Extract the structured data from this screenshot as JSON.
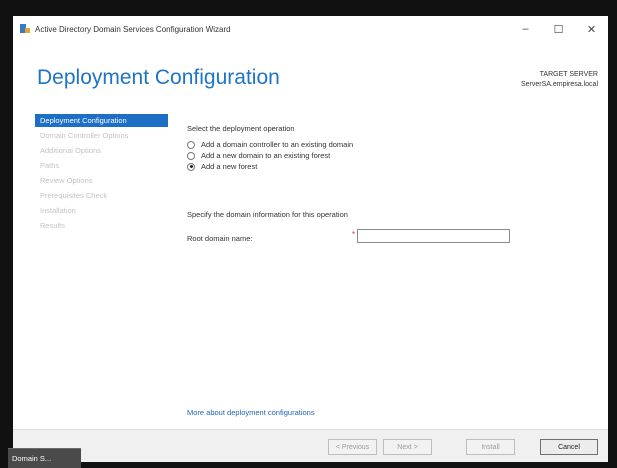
{
  "window": {
    "title": "Active Directory Domain Services Configuration Wizard",
    "controls": {
      "minimize": "–",
      "maximize": "☐",
      "close": "✕"
    }
  },
  "header": {
    "title": "Deployment Configuration",
    "target_label": "TARGET SERVER",
    "target_value": "ServerSA.empiresa.local"
  },
  "sidebar": {
    "items": [
      {
        "label": "Deployment Configuration",
        "active": true
      },
      {
        "label": "Domain Controller Options",
        "active": false
      },
      {
        "label": "Additional Options",
        "active": false
      },
      {
        "label": "Paths",
        "active": false
      },
      {
        "label": "Review Options",
        "active": false
      },
      {
        "label": "Prerequisites Check",
        "active": false
      },
      {
        "label": "Installation",
        "active": false
      },
      {
        "label": "Results",
        "active": false
      }
    ]
  },
  "main": {
    "select_operation_label": "Select the deployment operation",
    "options": [
      {
        "label": "Add a domain controller to an existing domain",
        "checked": false
      },
      {
        "label": "Add a new domain to an existing forest",
        "checked": false
      },
      {
        "label": "Add a new forest",
        "checked": true
      }
    ],
    "specify_label": "Specify the domain information for this operation",
    "root_domain_label": "Root domain name:",
    "root_domain_value": "",
    "required_marker": "*",
    "more_link": "More about deployment configurations"
  },
  "footer": {
    "previous": "< Previous",
    "next": "Next >",
    "install": "Install",
    "cancel": "Cancel"
  },
  "taskbar": {
    "item": "Domain S..."
  }
}
